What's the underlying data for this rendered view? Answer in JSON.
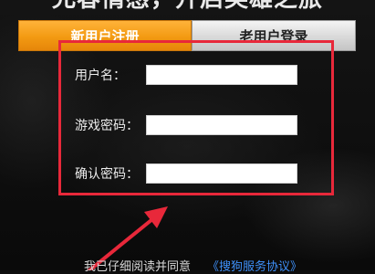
{
  "header": {
    "headline": "允春情感，开启英雄之旅"
  },
  "tabs": [
    {
      "label": "新用户注册",
      "active": true
    },
    {
      "label": "老用户登录",
      "active": false
    }
  ],
  "form": {
    "username_label": "用户名：",
    "username_value": "",
    "password_label": "游戏密码：",
    "password_value": "",
    "confirm_label": "确认密码：",
    "confirm_value": ""
  },
  "footer": {
    "agree_text": "我已仔细阅读并同意",
    "agreement_link": "《搜狗服务协议》"
  },
  "colors": {
    "tab_active": "#f39a12",
    "highlight_box": "#e8283a",
    "link": "#3e8ff7"
  }
}
